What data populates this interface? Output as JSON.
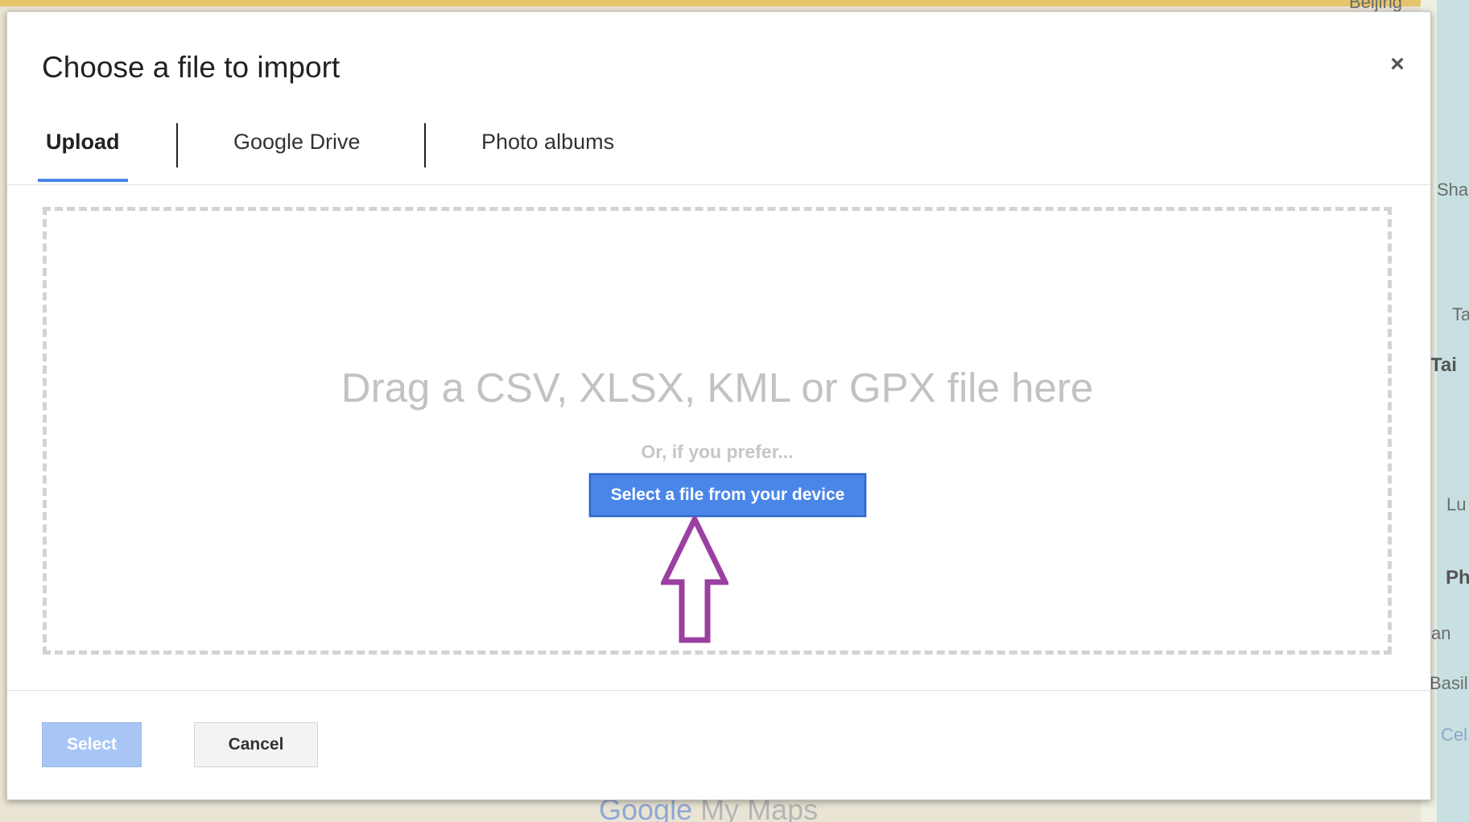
{
  "dialog": {
    "title": "Choose a file to import",
    "close_glyph": "×"
  },
  "tabs": [
    {
      "label": "Upload",
      "active": true
    },
    {
      "label": "Google Drive",
      "active": false
    },
    {
      "label": "Photo albums",
      "active": false
    }
  ],
  "dropzone": {
    "drag_text": "Drag a CSV, XLSX, KML or GPX file here",
    "prefer_text": "Or, if you prefer...",
    "select_file_label": "Select a file from your device"
  },
  "footer": {
    "select_label": "Select",
    "cancel_label": "Cancel"
  },
  "map": {
    "labels": [
      "Beijing",
      "Sha",
      "Ta",
      "Tai",
      "Lu",
      "Ph",
      "an",
      "Basil",
      "Cel"
    ],
    "watermark_google": "Google",
    "watermark_product": "My Maps"
  },
  "annotation": {
    "icon": "up-arrow-icon",
    "color": "#9b3fa0"
  },
  "colors": {
    "accent": "#4a86e8",
    "disabled_button": "#a8c6f5"
  }
}
